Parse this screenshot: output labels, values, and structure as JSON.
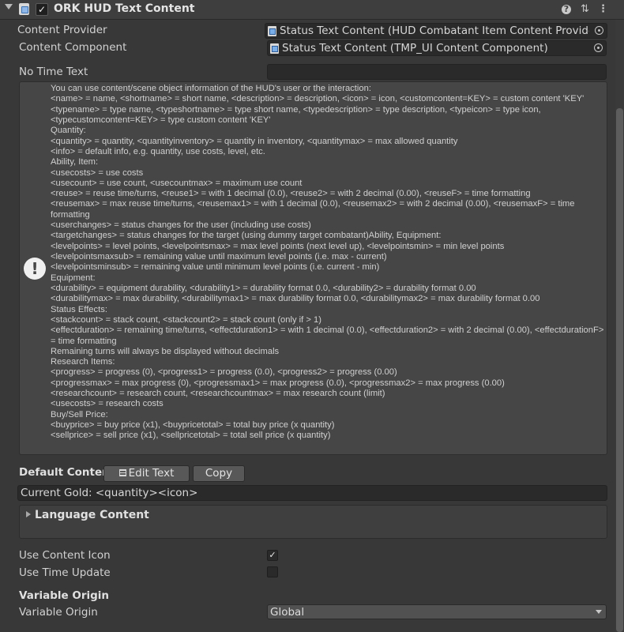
{
  "header": {
    "title": "ORK HUD Text Content",
    "icons": [
      "help-icon",
      "preset-icon",
      "more-menu-icon"
    ],
    "enabled": true
  },
  "fields": {
    "content_provider_label": "Content Provider",
    "content_provider_value": "Status Text Content (HUD Combatant Item Content Provider Co",
    "content_component_label": "Content Component",
    "content_component_value": "Status Text Content (TMP_UI Content Component)",
    "no_time_text_label": "No Time Text",
    "no_time_text_value": ""
  },
  "help": {
    "icon": "warning-icon",
    "lines": [
      "You can use content/scene object information of the HUD's user or the interaction:",
      "<name> = name, <shortname> = short name, <description> = description, <icon> = icon, <customcontent=KEY> = custom content 'KEY'",
      "<typename> = type name, <typeshortname> = type short name, <typedescription> = type description, <typeicon> = type icon, <typecustomcontent=KEY> = type custom content 'KEY'",
      "Quantity:",
      "<quantity> = quantity, <quantityinventory> = quantity in inventory, <quantitymax> = max allowed quantity",
      "<info> = default info, e.g. quantity, use costs, level, etc.",
      "Ability, Item:",
      "<usecosts> = use costs",
      "<usecount> = use count, <usecountmax> = maximum use count",
      "<reuse> = reuse time/turns, <reuse1> = with 1 decimal (0.0), <reuse2> = with 2 decimal (0.00), <reuseF> = time formatting",
      "<reusemax> = max reuse time/turns, <reusemax1> = with 1 decimal (0.0), <reusemax2> = with 2 decimal (0.00), <reusemaxF> = time formatting",
      "<userchanges> = status changes for the user (including use costs)",
      "<targetchanges> = status changes for the target (using dummy target combatant)Ability, Equipment:",
      "<levelpoints> = level points, <levelpointsmax> = max level points (next level up), <levelpointsmin> = min level points",
      "<levelpointsmaxsub> = remaining value until maximum level points (i.e. max - current)",
      "<levelpointsminsub> = remaining value until minimum level points (i.e. current - min)",
      "Equipment:",
      "<durability> = equipment durability, <durability1> = durability format 0.0, <durability2> = durability format 0.00",
      "<durabilitymax> = max durability, <durabilitymax1> = max durability format 0.0, <durabilitymax2> = max durability format 0.00",
      "Status Effects:",
      "<stackcount> = stack count, <stackcount2> = stack count (only if > 1)",
      "<effectduration> = remaining time/turns, <effectduration1> = with 1 decimal (0.0), <effectduration2> = with 2 decimal (0.00), <effectdurationF> = time formatting",
      "Remaining turns will always be displayed without decimals",
      "Research Items:",
      "<progress> = progress (0), <progress1> = progress (0.0), <progress2> = progress (0.00)",
      "<progressmax> = max progress (0), <progressmax1> = max progress (0.0), <progressmax2> = max progress (0.00)",
      "<researchcount> = research count, <researchcountmax> = max research count (limit)",
      "<usecosts> = research costs",
      "Buy/Sell Price:",
      "<buyprice> = buy price (x1), <buypricetotal> = total buy price (x quantity)",
      "<sellprice> = sell price (x1), <sellpricetotal> = total sell price (x quantity)"
    ]
  },
  "default_content": {
    "label": "Default Content",
    "edit_button": "Edit Text",
    "copy_button": "Copy",
    "value": "Current Gold: <quantity><icon>"
  },
  "language_content": {
    "label": "Language Content",
    "expanded": false
  },
  "toggles": {
    "use_content_icon_label": "Use Content Icon",
    "use_content_icon": true,
    "use_time_update_label": "Use Time Update",
    "use_time_update": false
  },
  "variable_origin": {
    "section_label": "Variable Origin",
    "field_label": "Variable Origin",
    "value": "Global"
  },
  "colors": {
    "background": "#383838",
    "field": "#2a2a2a",
    "helpbox": "#464646"
  }
}
